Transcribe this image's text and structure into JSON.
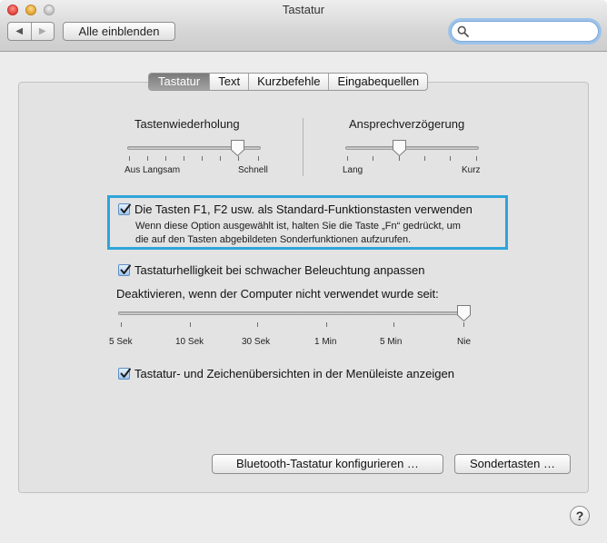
{
  "window": {
    "title": "Tastatur"
  },
  "toolbar": {
    "back_icon": "back-arrow-icon",
    "forward_icon": "forward-arrow-icon",
    "show_all_label": "Alle einblenden",
    "search_value": "",
    "search_icon": "search-icon"
  },
  "tabs": [
    {
      "label": "Tastatur",
      "active": true
    },
    {
      "label": "Text",
      "active": false
    },
    {
      "label": "Kurzbefehle",
      "active": false
    },
    {
      "label": "Eingabequellen",
      "active": false
    }
  ],
  "key_repeat": {
    "label": "Tastenwiederholung",
    "min_labels": [
      "Aus",
      "Langsam"
    ],
    "max_label": "Schnell",
    "value_fraction": 0.875
  },
  "delay_until_repeat": {
    "label": "Ansprechverzögerung",
    "min_label": "Lang",
    "max_label": "Kurz",
    "value_fraction": 0.4
  },
  "fn_keys": {
    "checked": true,
    "label": "Die Tasten F1, F2 usw. als Standard-Funktionstasten verwenden",
    "description_line1": "Wenn diese Option ausgewählt ist, halten Sie die Taste „Fn“ gedrückt, um",
    "description_line2": "die auf den Tasten abgebildeten Sonderfunktionen aufzurufen."
  },
  "brightness": {
    "checked": true,
    "label": "Tastaturhelligkeit bei schwacher Beleuchtung anpassen"
  },
  "deactivate": {
    "label": "Deaktivieren, wenn der Computer nicht verwendet wurde seit:",
    "tick_labels": [
      "5 Sek",
      "10 Sek",
      "30 Sek",
      "1 Min",
      "5 Min",
      "Nie"
    ],
    "selected": "Nie"
  },
  "viewer_menu": {
    "checked": true,
    "label": "Tastatur- und Zeichenübersichten in der Menüleiste anzeigen"
  },
  "buttons": {
    "bluetooth_label": "Bluetooth-Tastatur konfigurieren …",
    "modifier_label": "Sondertasten …"
  },
  "help_label": "?"
}
